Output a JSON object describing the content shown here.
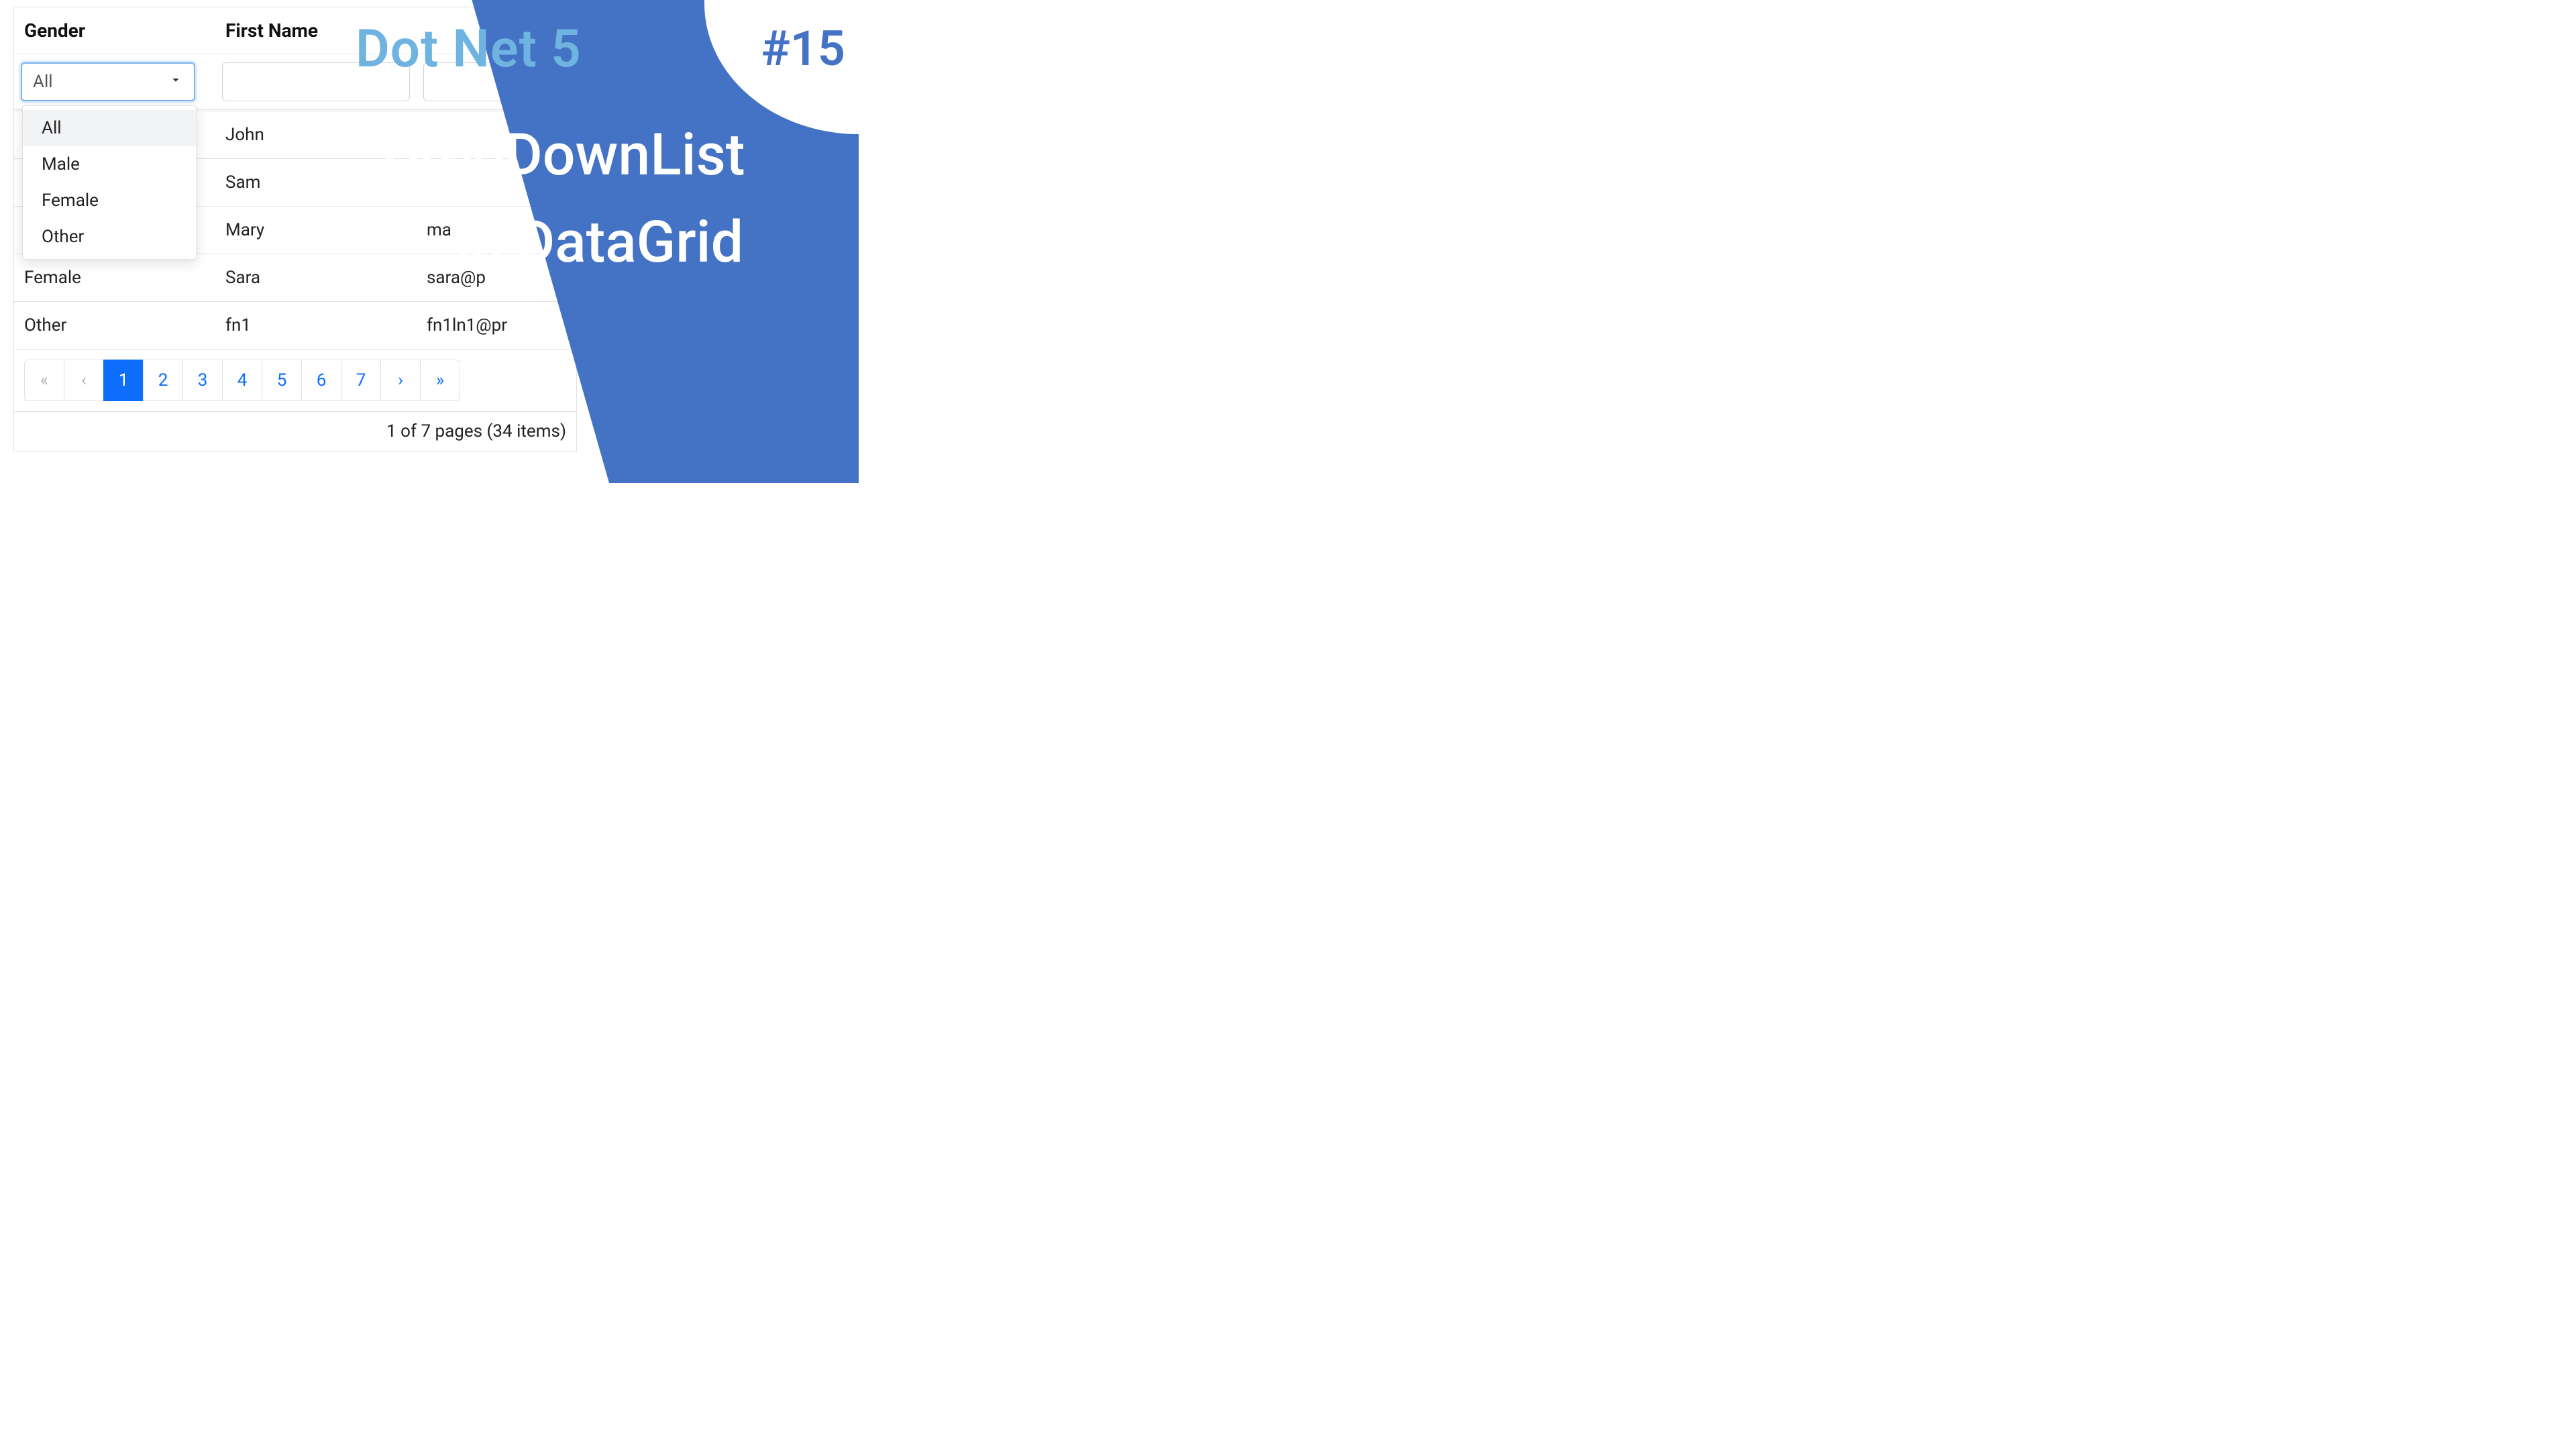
{
  "table": {
    "headers": {
      "gender": "Gender",
      "firstName": "First Name"
    },
    "filter": {
      "genderSelected": "All",
      "options": [
        "All",
        "Male",
        "Female",
        "Other"
      ]
    },
    "rows": [
      {
        "gender": "",
        "firstName": "John",
        "email": ""
      },
      {
        "gender": "",
        "firstName": "Sam",
        "email": ""
      },
      {
        "gender": "",
        "firstName": "Mary",
        "email": "ma"
      },
      {
        "gender": "Female",
        "firstName": "Sara",
        "email": "sara@p"
      },
      {
        "gender": "Other",
        "firstName": "fn1",
        "email": "fn1ln1@pr"
      }
    ],
    "pagination": {
      "pages": [
        "1",
        "2",
        "3",
        "4",
        "5",
        "6",
        "7"
      ],
      "active": 1
    },
    "status": "1 of 7 pages (34 items)"
  },
  "overlay": {
    "series": "Dot Net 5",
    "episode": "#15",
    "line1": "DropDownList",
    "line2": "in DataGrid"
  }
}
